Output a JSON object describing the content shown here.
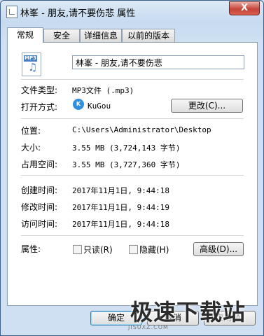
{
  "window": {
    "title": "林峯 - 朋友,请不要伤悲 属性",
    "close_label": "X"
  },
  "tabs": [
    "常规",
    "安全",
    "详细信息",
    "以前的版本"
  ],
  "file": {
    "icon_label": "MP3",
    "icon_glyph": "♫",
    "name": "林峯 - 朋友,请不要伤悲"
  },
  "general": {
    "type_label": "文件类型:",
    "type_value": "MP3文件 (.mp3)",
    "open_with_label": "打开方式:",
    "app_name": "KuGou",
    "app_icon_text": "K",
    "change_button": "更改(C)...",
    "location_label": "位置:",
    "location_value": "C:\\Users\\Administrator\\Desktop",
    "size_label": "大小:",
    "size_value": "3.55 MB (3,724,143 字节)",
    "size_on_disk_label": "占用空间:",
    "size_on_disk_value": "3.55 MB (3,727,360 字节)",
    "created_label": "创建时间:",
    "created_value": "2017年11月1日, 9:44:18",
    "modified_label": "修改时间:",
    "modified_value": "2017年11月1日, 9:44:19",
    "accessed_label": "访问时间:",
    "accessed_value": "2017年11月1日, 9:44:18",
    "attributes_label": "属性:",
    "readonly_label": "只读(R)",
    "hidden_label": "隐藏(H)",
    "advanced_button": "高级(D)..."
  },
  "buttons": {
    "ok": "确定",
    "cancel": "取消",
    "apply": "应用(A)"
  },
  "watermark": {
    "text": "极速下载站",
    "sub": "JISUXZ.COM"
  }
}
